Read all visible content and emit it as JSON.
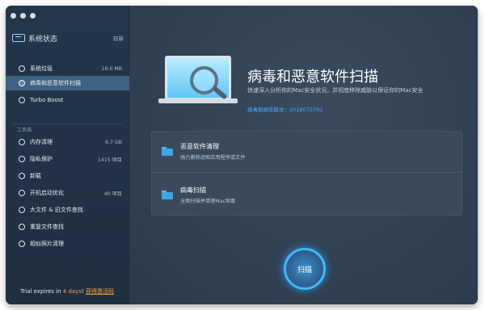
{
  "sidebar": {
    "title": "系统状态",
    "title_right": "较新",
    "items": [
      {
        "label": "系统垃圾",
        "value": "16.0 MB"
      },
      {
        "label": "病毒和恶意软件扫描",
        "value": ""
      },
      {
        "label": "Turbo Boost",
        "value": ""
      }
    ],
    "section_title": "工具箱",
    "tools": [
      {
        "label": "内存清理",
        "value": "6.7 GB"
      },
      {
        "label": "隐私保护",
        "value": "1415 项目"
      },
      {
        "label": "卸载",
        "value": ""
      },
      {
        "label": "开机启动优化",
        "value": "40 项目"
      },
      {
        "label": "大文件 & 旧文件查找",
        "value": ""
      },
      {
        "label": "重复文件查找",
        "value": ""
      },
      {
        "label": "相似照片清理",
        "value": ""
      }
    ],
    "trial_prefix": "Trial expires in ",
    "trial_days": "4 days",
    "trial_bang": "! ",
    "trial_link": "获得激活码"
  },
  "main": {
    "title": "病毒和恶意软件扫描",
    "subtitle": "快速深入分析你的Mac安全状况，并彻底移除威胁以保证你的Mac安全",
    "version": "病毒数据库版本：2018072701",
    "panel_rows": [
      {
        "title": "恶意软件清理",
        "desc": "强力删除迹图应用程序或文件"
      },
      {
        "title": "病毒扫描",
        "desc": "全面扫描并清理Mac病毒"
      }
    ],
    "scan_button": "扫描"
  },
  "colors": {
    "sidebar_bg": "#24364b",
    "main_bg": "#314152",
    "accent": "#43b8ff",
    "trial_accent": "#f0a23b",
    "version_text": "#49a8ff"
  },
  "icons": [
    "system-status-icon",
    "broom-icon",
    "shield-scan-icon",
    "turbo-icon",
    "memory-icon",
    "privacy-icon",
    "uninstall-icon",
    "startup-icon",
    "large-files-icon",
    "duplicate-icon",
    "photo-icon",
    "folder-icon",
    "laptop-magnifier-icon"
  ]
}
